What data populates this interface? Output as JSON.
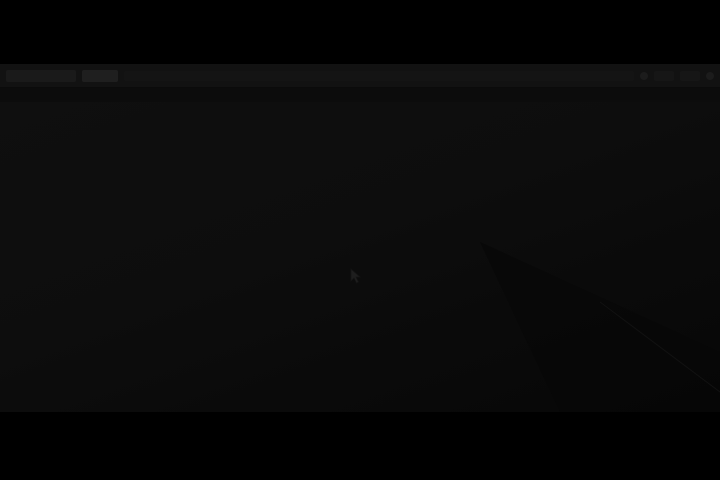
{
  "window": {
    "toolbar": {
      "items": [
        "",
        "",
        ""
      ]
    }
  },
  "colors": {
    "background": "#000000",
    "window": "#0a0a0a",
    "toolbar": "#121212"
  },
  "icons": {
    "cursor": "mouse-pointer-icon",
    "toolbar_right": "circle-icon"
  }
}
